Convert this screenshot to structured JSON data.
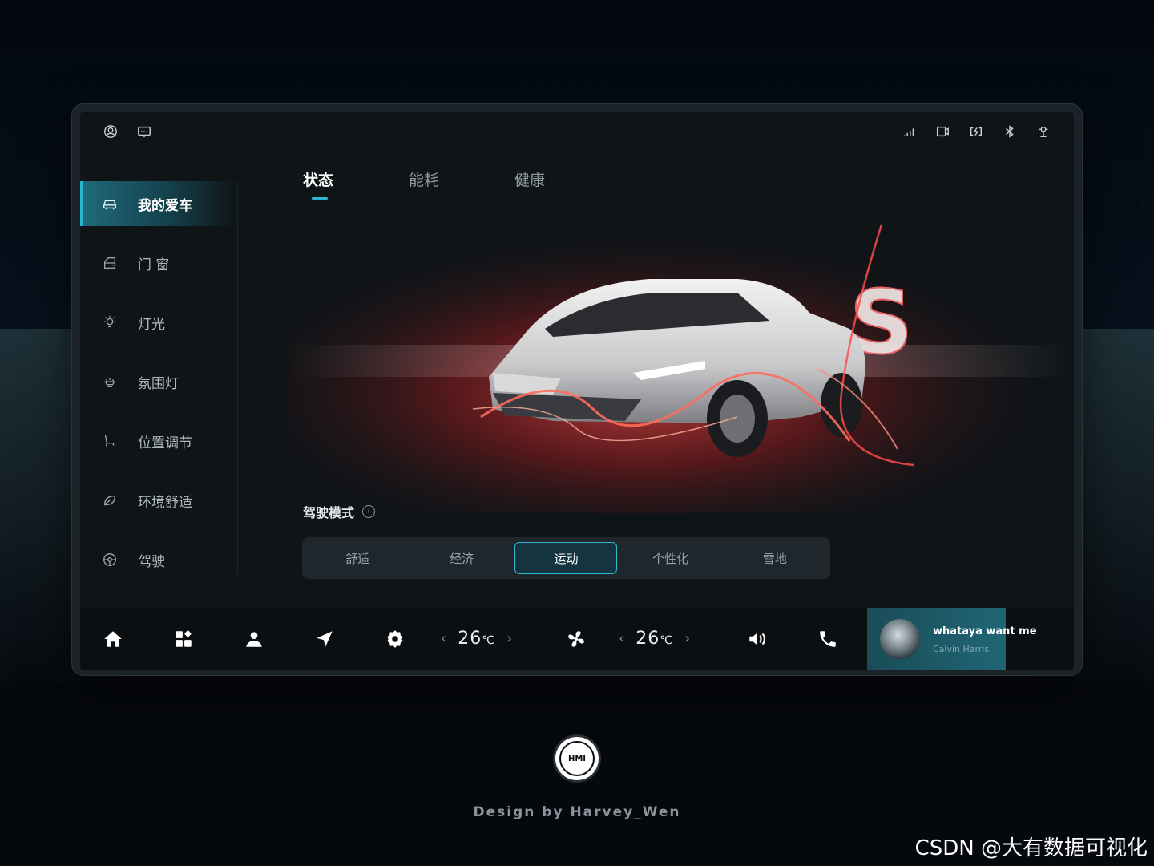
{
  "status_bar": {
    "left_icons": [
      "user-circle-icon",
      "message-icon"
    ],
    "right_icons": [
      "signal-icon",
      "screen-record-icon",
      "charge-icon",
      "bluetooth-icon",
      "wifi-icon"
    ]
  },
  "sidebar": {
    "items": [
      {
        "label": "我的爱车",
        "icon": "car-icon",
        "active": true
      },
      {
        "label": "门 窗",
        "icon": "door-icon",
        "active": false
      },
      {
        "label": "灯光",
        "icon": "light-icon",
        "active": false
      },
      {
        "label": "氛围灯",
        "icon": "ambient-light-icon",
        "active": false
      },
      {
        "label": "位置调节",
        "icon": "seat-icon",
        "active": false
      },
      {
        "label": "环境舒适",
        "icon": "leaf-icon",
        "active": false
      },
      {
        "label": "驾驶",
        "icon": "steering-wheel-icon",
        "active": false
      }
    ]
  },
  "tabs": [
    {
      "label": "状态",
      "active": true
    },
    {
      "label": "能耗",
      "active": false
    },
    {
      "label": "健康",
      "active": false
    }
  ],
  "hero": {
    "badge": "S"
  },
  "drive_mode": {
    "title": "驾驶模式",
    "info_icon": "info-icon",
    "options": [
      "舒适",
      "经济",
      "运动",
      "个性化",
      "雪地"
    ],
    "selected": "运动"
  },
  "dock": {
    "icons": [
      "home-icon",
      "apps-icon",
      "profile-icon",
      "navigation-icon",
      "settings-icon",
      "fan-icon",
      "volume-icon",
      "phone-icon"
    ],
    "left_temp": {
      "value": "26",
      "unit": "℃"
    },
    "right_temp": {
      "value": "26",
      "unit": "℃"
    },
    "left_arrow": "‹",
    "right_arrow": "›"
  },
  "music": {
    "song": "whataya want me",
    "artist": "Calvin Harris"
  },
  "footer": {
    "logo_text": "HMI",
    "credit": "Design by Harvey_Wen"
  },
  "watermark": "CSDN @大有数据可视化",
  "colors": {
    "accent": "#2bb8d6",
    "background": "#0f1417",
    "hero_red": "#ff3b3b"
  }
}
